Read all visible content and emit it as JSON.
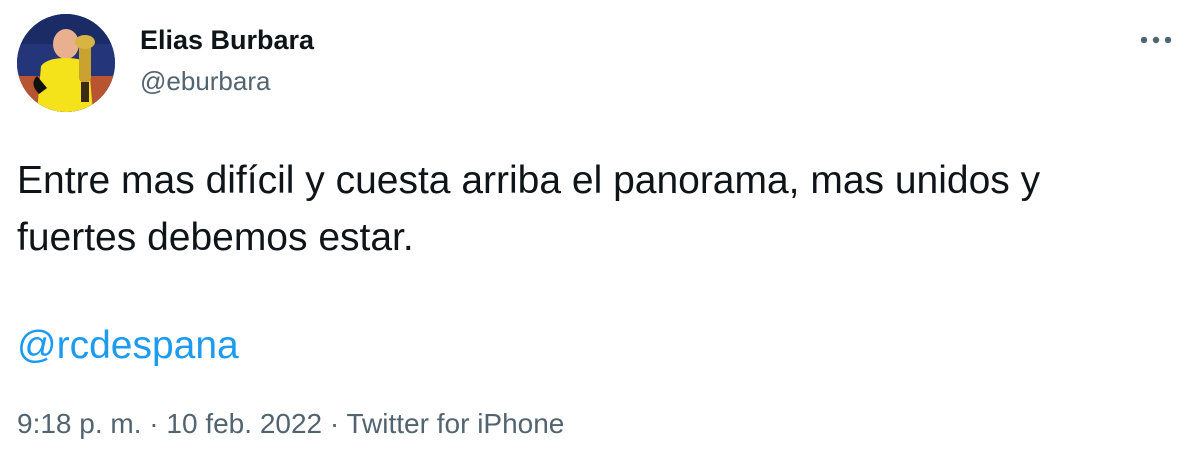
{
  "author": {
    "display_name": "Elias Burbara",
    "handle": "@eburbara"
  },
  "tweet": {
    "text": "Entre mas difícil y cuesta arriba el panorama, mas unidos y fuertes debemos estar.",
    "mention": "@rcdespana"
  },
  "meta": {
    "time": "9:18 p. m.",
    "separator": "·",
    "date": "10 feb. 2022",
    "source": "Twitter for iPhone"
  },
  "icons": {
    "more": "more-dots-icon"
  },
  "colors": {
    "text": "#0f1419",
    "secondary": "#536471",
    "link": "#1d9bf0"
  }
}
